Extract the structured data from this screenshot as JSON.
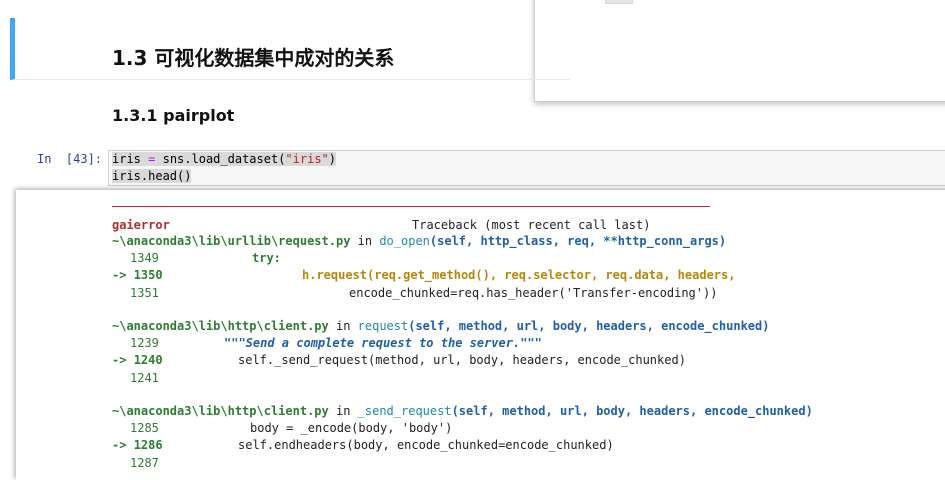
{
  "notebook": {
    "heading_2": "1.3  可视化数据集中成对的关系",
    "heading_3": "1.3.1  pairplot"
  },
  "input_cell": {
    "prompt": "In  [43]:",
    "code_line_1_a": "iris",
    "code_line_1_op": " = ",
    "code_line_1_b": "sns.load_dataset(",
    "code_line_1_str": "\"iris\"",
    "code_line_1_c": ")",
    "code_line_2": "iris.head()"
  },
  "traceback": {
    "error_name": "gaierror",
    "header": "Traceback (most recent call last)",
    "frames": [
      {
        "file": "~\\anaconda3\\lib\\urllib\\request.py",
        "in_word": " in ",
        "func": "do_open",
        "args": "(self, http_class, req, **http_conn_args)",
        "lines": [
          {
            "num": "1349",
            "arrow": "",
            "code": "try:"
          },
          {
            "num": "1350",
            "arrow": "-> ",
            "code_a": "h.request(req.get_method(), req.selector, req.data, headers,"
          },
          {
            "num": "1351",
            "arrow": "",
            "code": "encode_chunked=req.has_header('Transfer-encoding'))"
          }
        ]
      },
      {
        "file": "~\\anaconda3\\lib\\http\\client.py",
        "in_word": " in ",
        "func": "request",
        "args": "(self, method, url, body, headers, encode_chunked)",
        "lines": [
          {
            "num": "1239",
            "arrow": "",
            "code": "\"\"\"Send a complete request to the server.\"\"\""
          },
          {
            "num": "1240",
            "arrow": "-> ",
            "code": "self._send_request(method, url, body, headers, encode_chunked)"
          },
          {
            "num": "1241",
            "arrow": "",
            "code": ""
          }
        ]
      },
      {
        "file": "~\\anaconda3\\lib\\http\\client.py",
        "in_word": " in ",
        "func": "_send_request",
        "args": "(self, method, url, body, headers, encode_chunked)",
        "lines": [
          {
            "num": "1285",
            "arrow": "",
            "code": "body = _encode(body, 'body')"
          },
          {
            "num": "1286",
            "arrow": "-> ",
            "code": "self.endheaders(body, encode_chunked=encode_chunked)"
          },
          {
            "num": "1287",
            "arrow": "",
            "code": ""
          }
        ]
      }
    ]
  },
  "colors": {
    "selection_bar": "#42a5f5",
    "prompt": "#303f9f",
    "error": "#b22b31"
  }
}
